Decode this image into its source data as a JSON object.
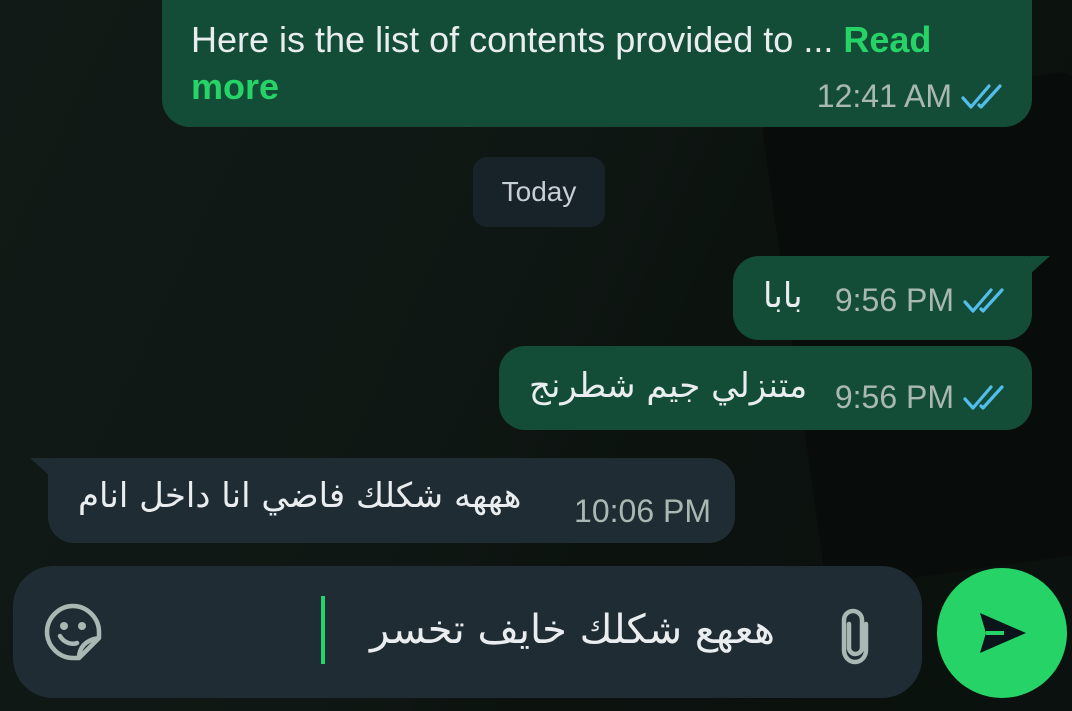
{
  "chat": {
    "messages": [
      {
        "direction": "outgoing",
        "text": "Here is the list of contents provided to ...",
        "read_more": "Read more",
        "time": "12:41 AM",
        "status": "read"
      },
      {
        "direction": "outgoing",
        "text": "بابا",
        "time": "9:56 PM",
        "status": "read"
      },
      {
        "direction": "outgoing",
        "text": "متنزلي جيم شطرنج",
        "time": "9:56 PM",
        "status": "read"
      },
      {
        "direction": "incoming",
        "text": "هههه شكلك فاضي انا داخل انام",
        "time": "10:06 PM"
      }
    ],
    "date_divider": "Today"
  },
  "composer": {
    "value": "هعهع شكلك خايف تخسر",
    "icons": {
      "left": "sticker-icon",
      "attach": "paperclip-icon",
      "send": "send-icon"
    }
  },
  "colors": {
    "outgoing_bubble": "#144d37",
    "incoming_bubble": "#202c33",
    "accent": "#25d366",
    "read_ticks": "#53bdeb"
  }
}
